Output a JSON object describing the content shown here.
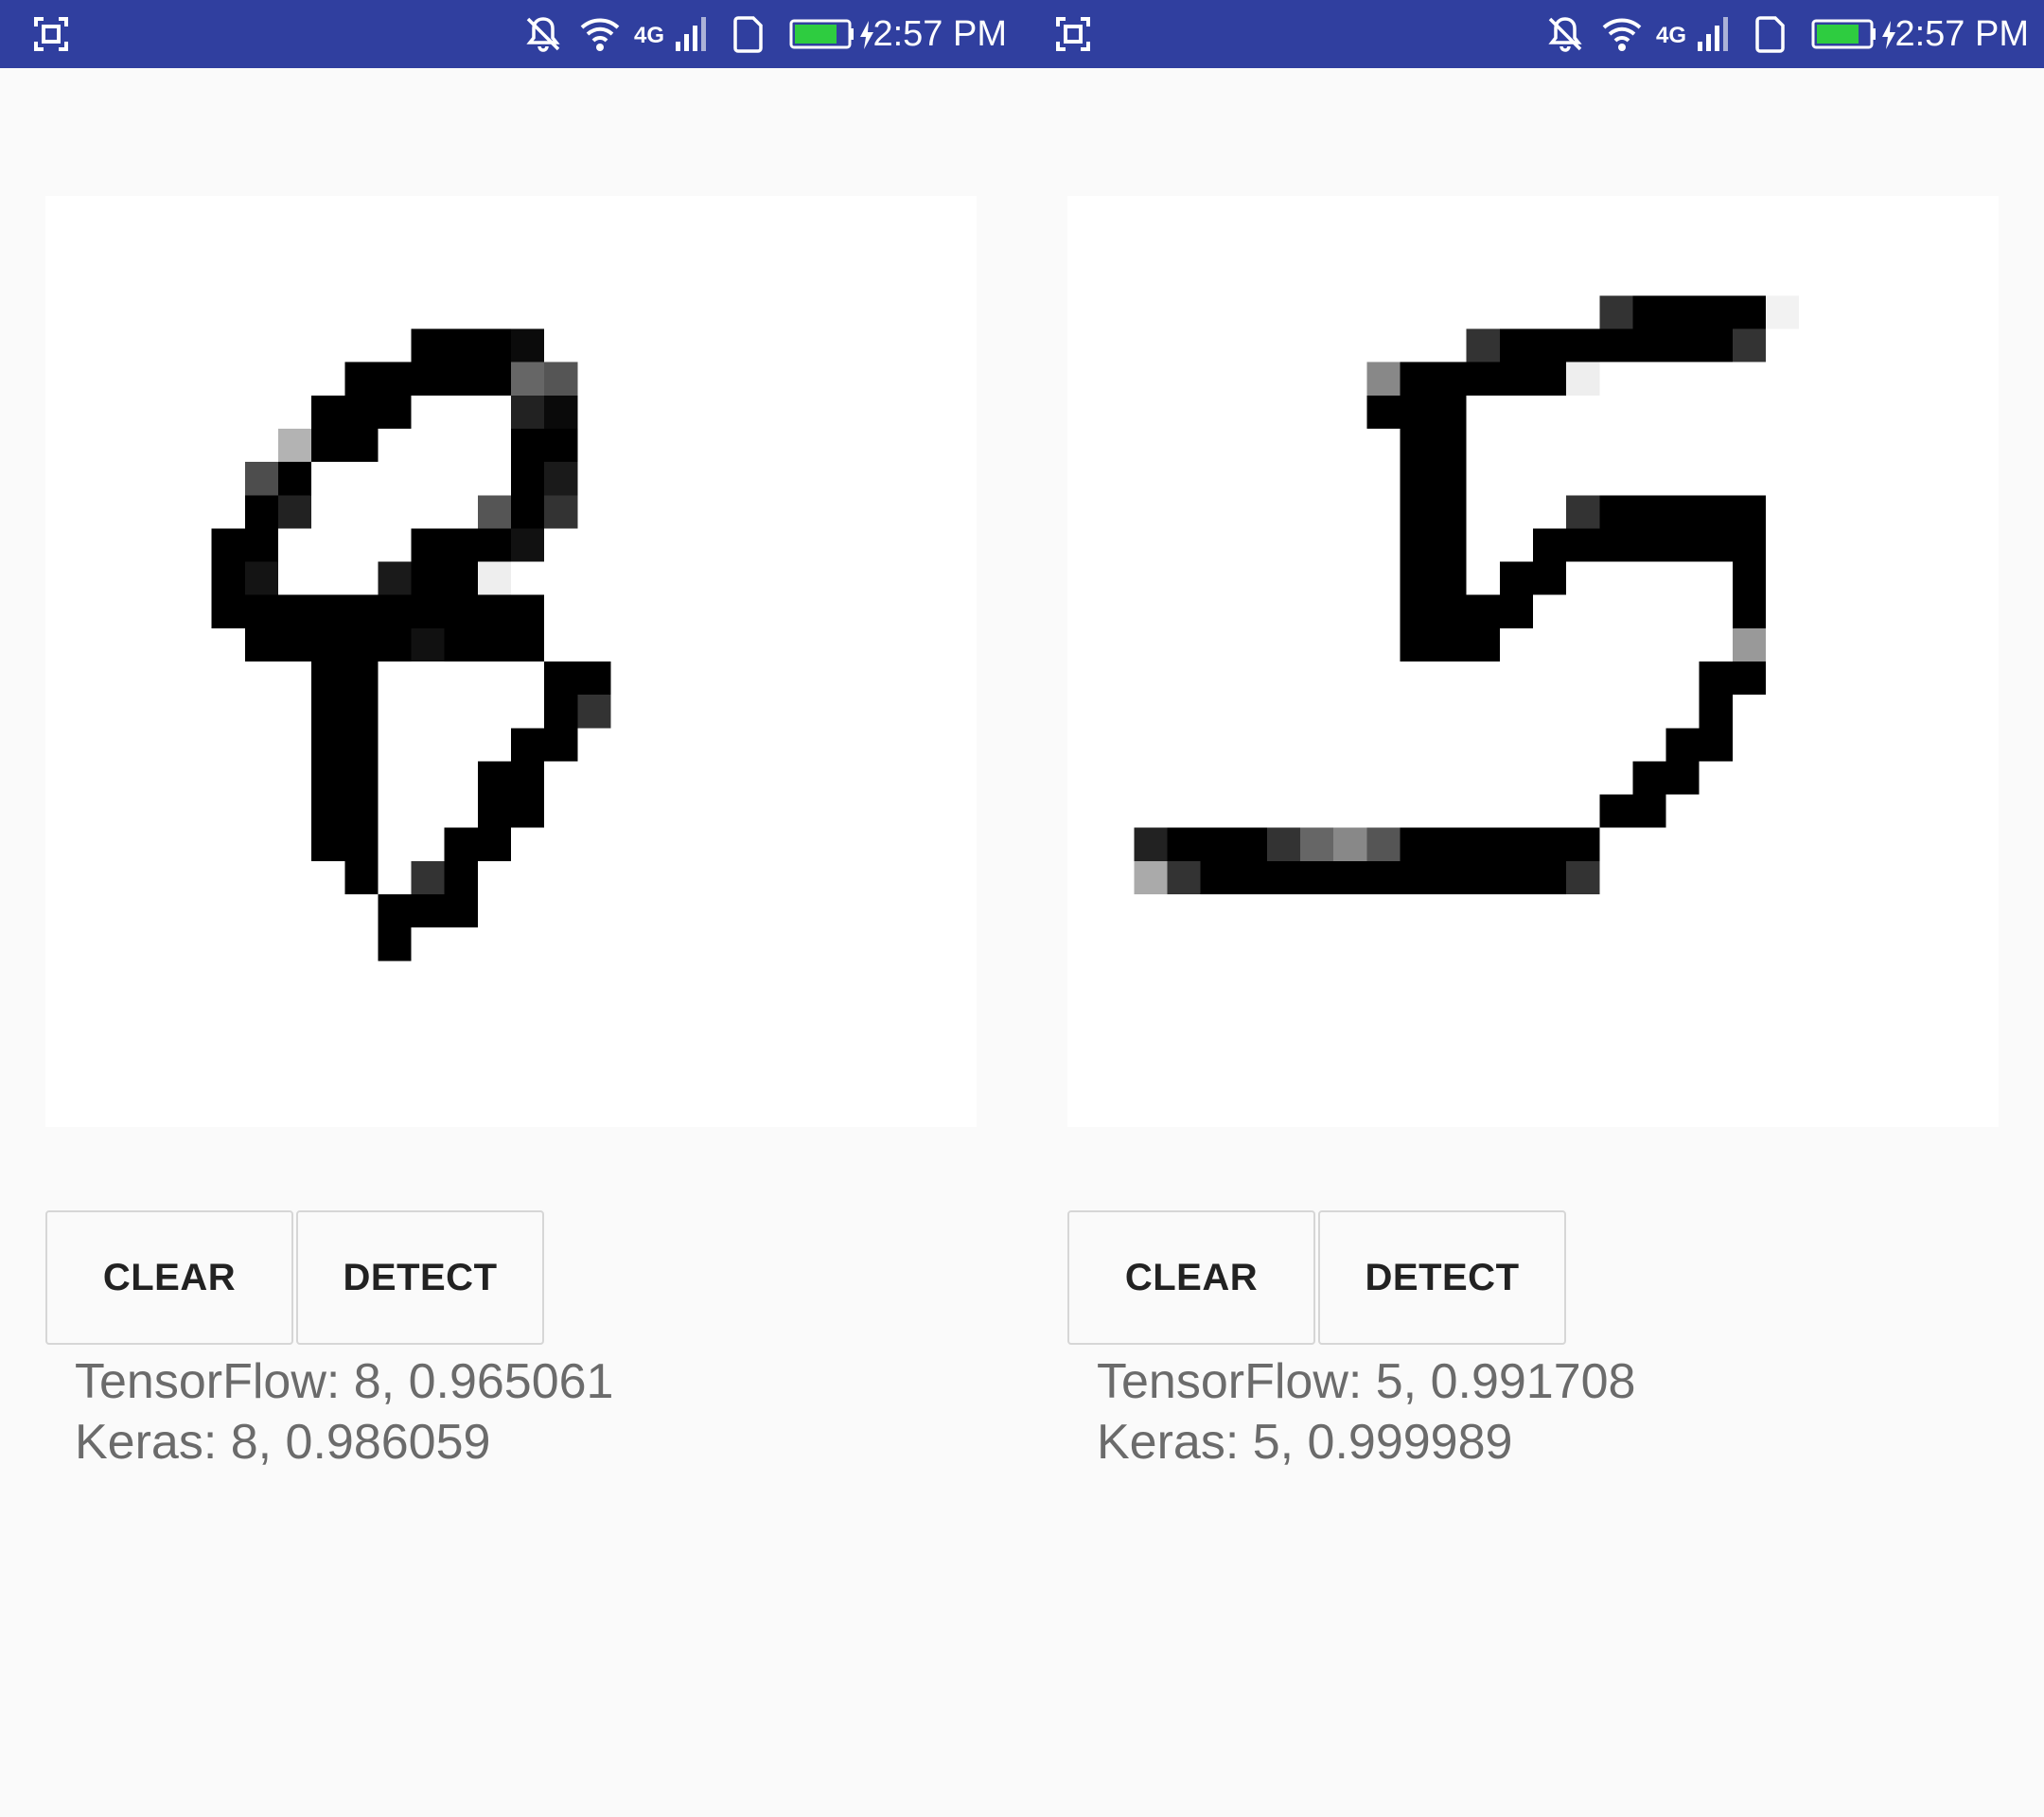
{
  "colors": {
    "status_bar": "#303f9f",
    "background": "#fafafa",
    "canvas": "#ffffff",
    "result_text": "#6b6b6b"
  },
  "status_bar": {
    "time": "2:57 PM",
    "network_label": "4G",
    "icons": [
      "screenshot-icon",
      "notifications-off-icon",
      "wifi-icon",
      "network-4g-icon",
      "signal-icon",
      "sim-icon",
      "battery-charging-icon"
    ]
  },
  "panels": [
    {
      "drawn_digit": "8",
      "clear_label": "CLEAR",
      "detect_label": "DETECT",
      "tensorflow_result": "TensorFlow: 8, 0.965061",
      "keras_result": "Keras: 8, 0.986059"
    },
    {
      "drawn_digit": "5",
      "clear_label": "CLEAR",
      "detect_label": "DETECT",
      "tensorflow_result": "TensorFlow: 5, 0.991708",
      "keras_result": "Keras: 5, 0.999989"
    }
  ]
}
